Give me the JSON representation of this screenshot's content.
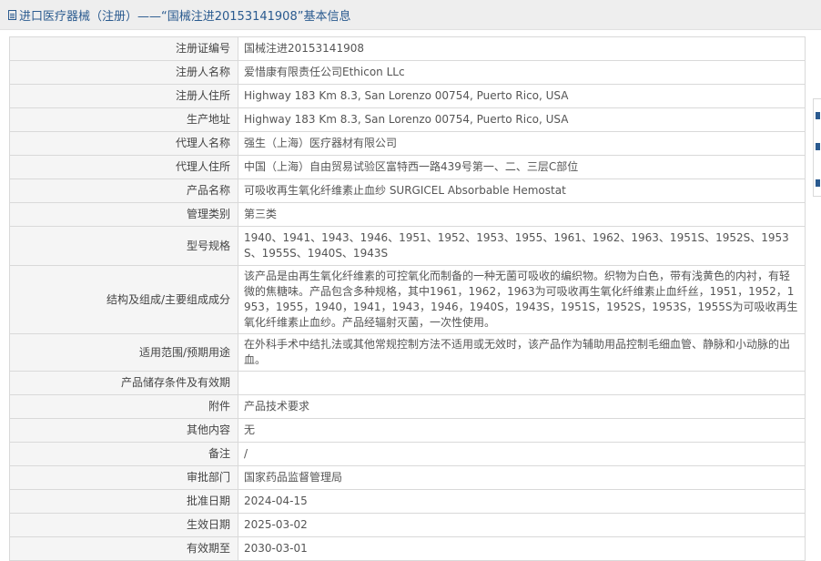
{
  "header": {
    "title": "进口医疗器械（注册）——“国械注进20153141908”基本信息"
  },
  "rows": [
    {
      "label": "注册证编号",
      "value": "国械注进20153141908",
      "h": 26
    },
    {
      "label": "注册人名称",
      "value": "爱惜康有限责任公司Ethicon LLc",
      "h": 26
    },
    {
      "label": "注册人住所",
      "value": "Highway 183 Km 8.3, San Lorenzo 00754, Puerto Rico, USA",
      "h": 26
    },
    {
      "label": "生产地址",
      "value": "Highway 183 Km 8.3, San Lorenzo 00754, Puerto Rico, USA",
      "h": 26
    },
    {
      "label": "代理人名称",
      "value": "强生（上海）医疗器材有限公司",
      "h": 26
    },
    {
      "label": "代理人住所",
      "value": "中国（上海）自由贸易试验区富特西一路439号第一、二、三层C部位",
      "h": 26
    },
    {
      "label": "产品名称",
      "value": "可吸收再生氧化纤维素止血纱 SURGICEL Absorbable Hemostat",
      "h": 26
    },
    {
      "label": "管理类别",
      "value": "第三类",
      "h": 26
    },
    {
      "label": "型号规格",
      "value": "1940、1941、1943、1946、1951、1952、1953、1955、1961、1962、1963、1951S、1952S、1953S、1955S、1940S、1943S",
      "h": 43
    },
    {
      "label": "结构及组成/主要组成成分",
      "value": "该产品是由再生氧化纤维素的可控氧化而制备的一种无菌可吸收的编织物。织物为白色，带有浅黄色的内衬，有轻微的焦糖味。产品包含多种规格，其中1961，1962，1963为可吸收再生氧化纤维素止血纤丝，1951，1952，1953，1955，1940，1941，1943，1946，1940S，1943S，1951S，1952S，1953S，1955S为可吸收再生氧化纤维素止血纱。产品经辐射灭菌，一次性使用。",
      "h": 60
    },
    {
      "label": "适用范围/预期用途",
      "value": "在外科手术中结扎法或其他常规控制方法不适用或无效时，该产品作为辅助用品控制毛细血管、静脉和小动脉的出血。",
      "h": 26
    },
    {
      "label": "产品储存条件及有效期",
      "value": "",
      "h": 26
    },
    {
      "label": "附件",
      "value": "产品技术要求",
      "h": 26
    },
    {
      "label": "其他内容",
      "value": "无",
      "h": 26
    },
    {
      "label": "备注",
      "value": "/",
      "h": 26
    },
    {
      "label": "审批部门",
      "value": "国家药品监督管理局",
      "h": 26
    },
    {
      "label": "批准日期",
      "value": "2024-04-15",
      "h": 26
    },
    {
      "label": "生效日期",
      "value": "2025-03-02",
      "h": 26
    },
    {
      "label": "有效期至",
      "value": "2030-03-01",
      "h": 26
    }
  ],
  "colors": {
    "title_blue": "#2a5a8f",
    "header_bg": "#eeeeee",
    "label_bg": "#f5f5f5",
    "border": "#d9d9d9"
  }
}
